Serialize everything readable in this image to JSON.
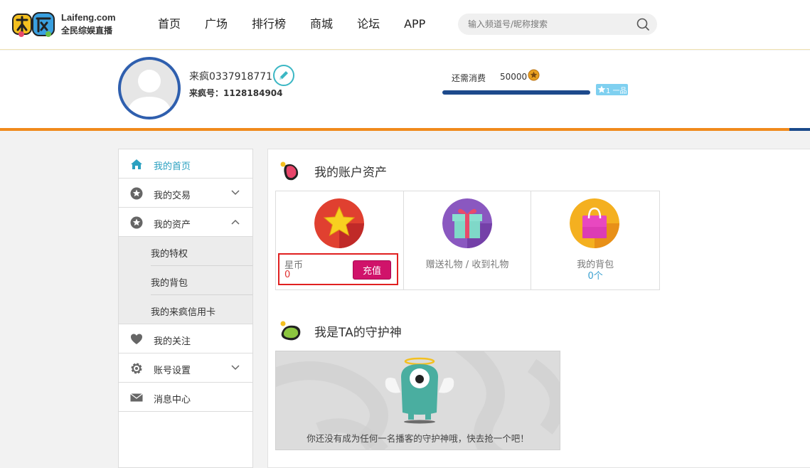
{
  "header": {
    "logo": {
      "domain": "Laifeng.com",
      "slogan": "全民综娱直播"
    },
    "nav": [
      {
        "label": "首页",
        "name": "nav-home"
      },
      {
        "label": "广场",
        "name": "nav-plaza"
      },
      {
        "label": "排行榜",
        "name": "nav-ranking"
      },
      {
        "label": "商城",
        "name": "nav-mall"
      },
      {
        "label": "论坛",
        "name": "nav-forum"
      },
      {
        "label": "APP",
        "name": "nav-app"
      }
    ],
    "search": {
      "placeholder": "输入频道号/昵称搜索",
      "icon": "search-icon"
    }
  },
  "profile": {
    "username": "来疯0337918771",
    "uid_text": "来疯号：1128184904",
    "need_label": "还需消费",
    "need_value": "50000",
    "progress_fraction": 1.0,
    "level_text": "1 一品",
    "colors": {
      "accent_line": "#f08a1c",
      "avatar_ring": "#2f5fae",
      "progress": "#1d4a8c"
    }
  },
  "sidebar": {
    "items": [
      {
        "label": "我的首页",
        "icon": "home-icon",
        "active": true
      },
      {
        "label": "我的交易",
        "icon": "star-icon",
        "chevron": "chevron-down-icon"
      },
      {
        "label": "我的资产",
        "icon": "star-icon",
        "chevron": "chevron-up-icon"
      },
      {
        "label": "我的关注",
        "icon": "heart-icon"
      },
      {
        "label": "账号设置",
        "icon": "gear-icon",
        "chevron": "chevron-down-icon"
      },
      {
        "label": "消息中心",
        "icon": "envelope-icon"
      }
    ],
    "sub_items": [
      {
        "label": "我的特权"
      },
      {
        "label": "我的背包"
      },
      {
        "label": "我的来疯信用卡"
      }
    ]
  },
  "assets": {
    "title": "我的账户资产",
    "star_coin": {
      "label": "星币",
      "value": "0",
      "button": "充值"
    },
    "gifts": {
      "label": "赠送礼物 / 收到礼物"
    },
    "backpack": {
      "label": "我的背包",
      "count": "0个"
    }
  },
  "guard": {
    "title": "我是TA的守护神",
    "empty_text": "你还没有成为任何一名播客的守护神哦，快去抢一个吧！"
  }
}
